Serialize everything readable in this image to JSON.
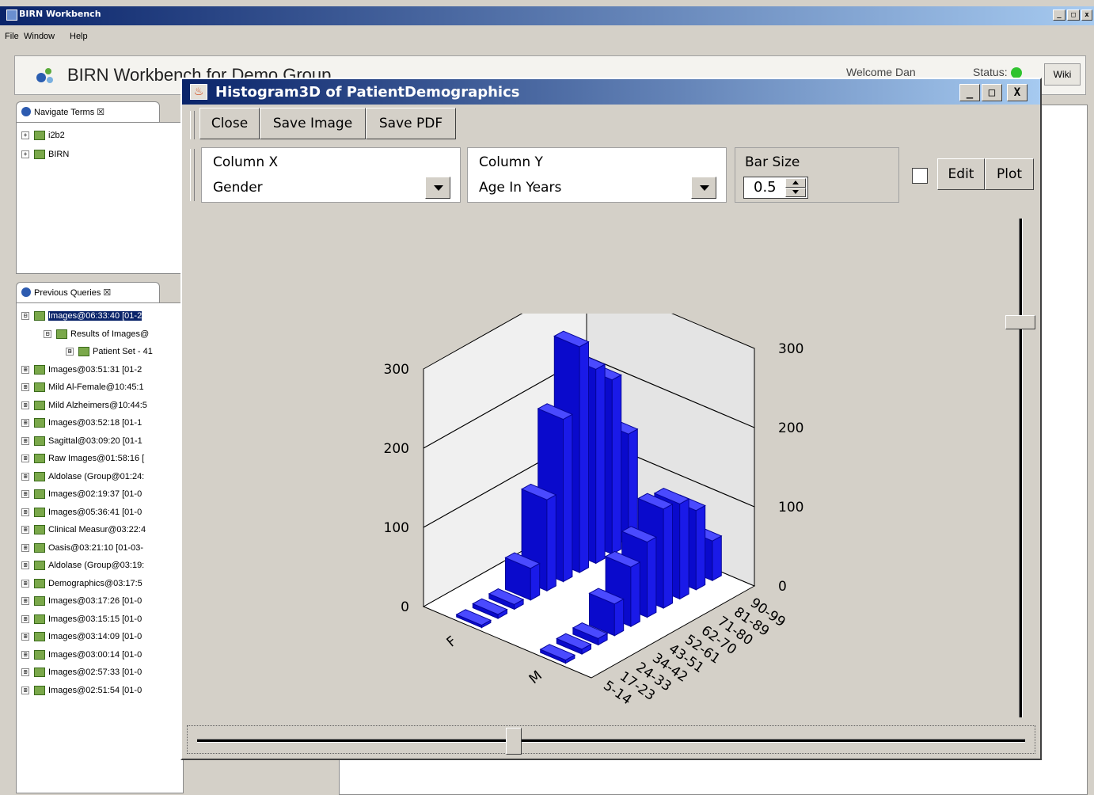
{
  "window": {
    "title": "BIRN Workbench",
    "controls": [
      "_",
      "□",
      "x"
    ]
  },
  "menu": [
    "File",
    "Window",
    "Help"
  ],
  "header": {
    "title": "BIRN Workbench for Demo Group",
    "welcome": "Welcome Dan",
    "status_label": "Status:",
    "wiki": "Wiki"
  },
  "navigate_panel": {
    "tab": "Navigate Terms ☒",
    "items": [
      "i2b2",
      "BIRN"
    ]
  },
  "queries_panel": {
    "tab": "Previous Queries ☒",
    "items": [
      {
        "label": "Images@06:33:40 [01-2",
        "expander": "⊟",
        "selected": true
      },
      {
        "label": "Results of Images@",
        "expander": "⊟"
      },
      {
        "label": "Patient Set - 41",
        "expander": "⊞"
      },
      {
        "label": "Images@03:51:31 [01-2",
        "expander": "⊞"
      },
      {
        "label": "Mild Al-Female@10:45:1",
        "expander": "⊞"
      },
      {
        "label": "Mild Alzheimers@10:44:5",
        "expander": "⊞"
      },
      {
        "label": "Images@03:52:18 [01-1",
        "expander": "⊞"
      },
      {
        "label": "Sagittal@03:09:20 [01-1",
        "expander": "⊞"
      },
      {
        "label": "Raw Images@01:58:16 [",
        "expander": "⊞"
      },
      {
        "label": "Aldolase (Group@01:24:",
        "expander": "⊞"
      },
      {
        "label": "Images@02:19:37 [01-0",
        "expander": "⊞"
      },
      {
        "label": "Images@05:36:41 [01-0",
        "expander": "⊞"
      },
      {
        "label": "Clinical Measur@03:22:4",
        "expander": "⊞"
      },
      {
        "label": "Oasis@03:21:10 [01-03-",
        "expander": "⊞"
      },
      {
        "label": "Aldolase (Group@03:19:",
        "expander": "⊞"
      },
      {
        "label": "Demographics@03:17:5",
        "expander": "⊞"
      },
      {
        "label": "Images@03:17:26 [01-0",
        "expander": "⊞"
      },
      {
        "label": "Images@03:15:15 [01-0",
        "expander": "⊞"
      },
      {
        "label": "Images@03:14:09 [01-0",
        "expander": "⊞"
      },
      {
        "label": "Images@03:00:14 [01-0",
        "expander": "⊞"
      },
      {
        "label": "Images@02:57:33 [01-0",
        "expander": "⊞"
      },
      {
        "label": "Images@02:51:54 [01-0",
        "expander": "⊞"
      }
    ]
  },
  "dialog": {
    "title": "Histogram3D of PatientDemographics",
    "icon": "♨",
    "controls": [
      "_",
      "□",
      "X"
    ],
    "toolbar": {
      "close": "Close",
      "save_image": "Save Image",
      "save_pdf": "Save PDF"
    },
    "column_x": {
      "label": "Column X",
      "value": "Gender"
    },
    "column_y": {
      "label": "Column Y",
      "value": "Age In Years"
    },
    "bar_size": {
      "label": "Bar Size",
      "value": "0.5"
    },
    "edit": "Edit",
    "plot": "Plot",
    "vertical_slider_value": 0.2,
    "horizontal_slider_value": 0.38
  },
  "chart_data": {
    "type": "bar3d",
    "x_axis_categories": [
      "F",
      "M"
    ],
    "y_axis_categories": [
      "5-14",
      "17-23",
      "24-33",
      "34-42",
      "43-51",
      "52-61",
      "62-70",
      "71-80",
      "81-89",
      "90-99"
    ],
    "z_ticks": [
      0,
      100,
      200,
      300
    ],
    "zlim": [
      0,
      300
    ],
    "color": "#1a1ae0",
    "series": [
      {
        "name": "F",
        "values": [
          3,
          5,
          6,
          40,
          115,
          205,
          285,
          245,
          220,
          140
        ]
      },
      {
        "name": "M",
        "values": [
          4,
          6,
          8,
          40,
          75,
          95,
          125,
          120,
          100,
          50
        ]
      }
    ]
  }
}
